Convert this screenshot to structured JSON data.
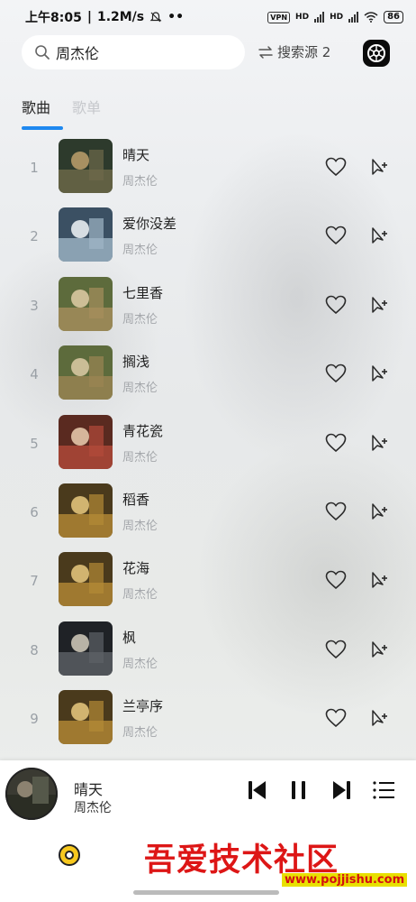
{
  "status_bar": {
    "time": "上午8:05",
    "speed": "1.2M/s",
    "vpn": "VPN",
    "hd1": "HD",
    "hd2": "HD",
    "battery": "86"
  },
  "search": {
    "value": "周杰伦",
    "placeholder": "",
    "source_label": "搜索源 2"
  },
  "tabs": [
    {
      "label": "歌曲",
      "active": true
    },
    {
      "label": "歌单",
      "active": false
    }
  ],
  "songs": [
    {
      "index": "1",
      "title": "晴天",
      "artist": "周杰伦"
    },
    {
      "index": "2",
      "title": "爱你没差",
      "artist": "周杰伦"
    },
    {
      "index": "3",
      "title": "七里香",
      "artist": "周杰伦"
    },
    {
      "index": "4",
      "title": "搁浅",
      "artist": "周杰伦"
    },
    {
      "index": "5",
      "title": "青花瓷",
      "artist": "周杰伦"
    },
    {
      "index": "6",
      "title": "稻香",
      "artist": "周杰伦"
    },
    {
      "index": "7",
      "title": "花海",
      "artist": "周杰伦"
    },
    {
      "index": "8",
      "title": "枫",
      "artist": "周杰伦"
    },
    {
      "index": "9",
      "title": "兰亭序",
      "artist": "周杰伦"
    }
  ],
  "now_playing": {
    "title": "晴天",
    "artist": "周杰伦"
  },
  "watermark": {
    "text": "吾爱技术社区",
    "url": "www.pojjishu.com"
  },
  "icons": {
    "search": "search-icon",
    "source": "swap-icon",
    "settings": "gear-icon",
    "like": "heart-icon",
    "add": "add-to-queue-icon",
    "prev": "skip-previous-icon",
    "pause": "pause-icon",
    "next": "skip-next-icon",
    "playlist": "playlist-icon",
    "home": "music-disc-icon"
  },
  "colors": {
    "accent": "#1e88f0",
    "watermark_red": "#dd1616",
    "watermark_yellow": "#e8e000"
  }
}
